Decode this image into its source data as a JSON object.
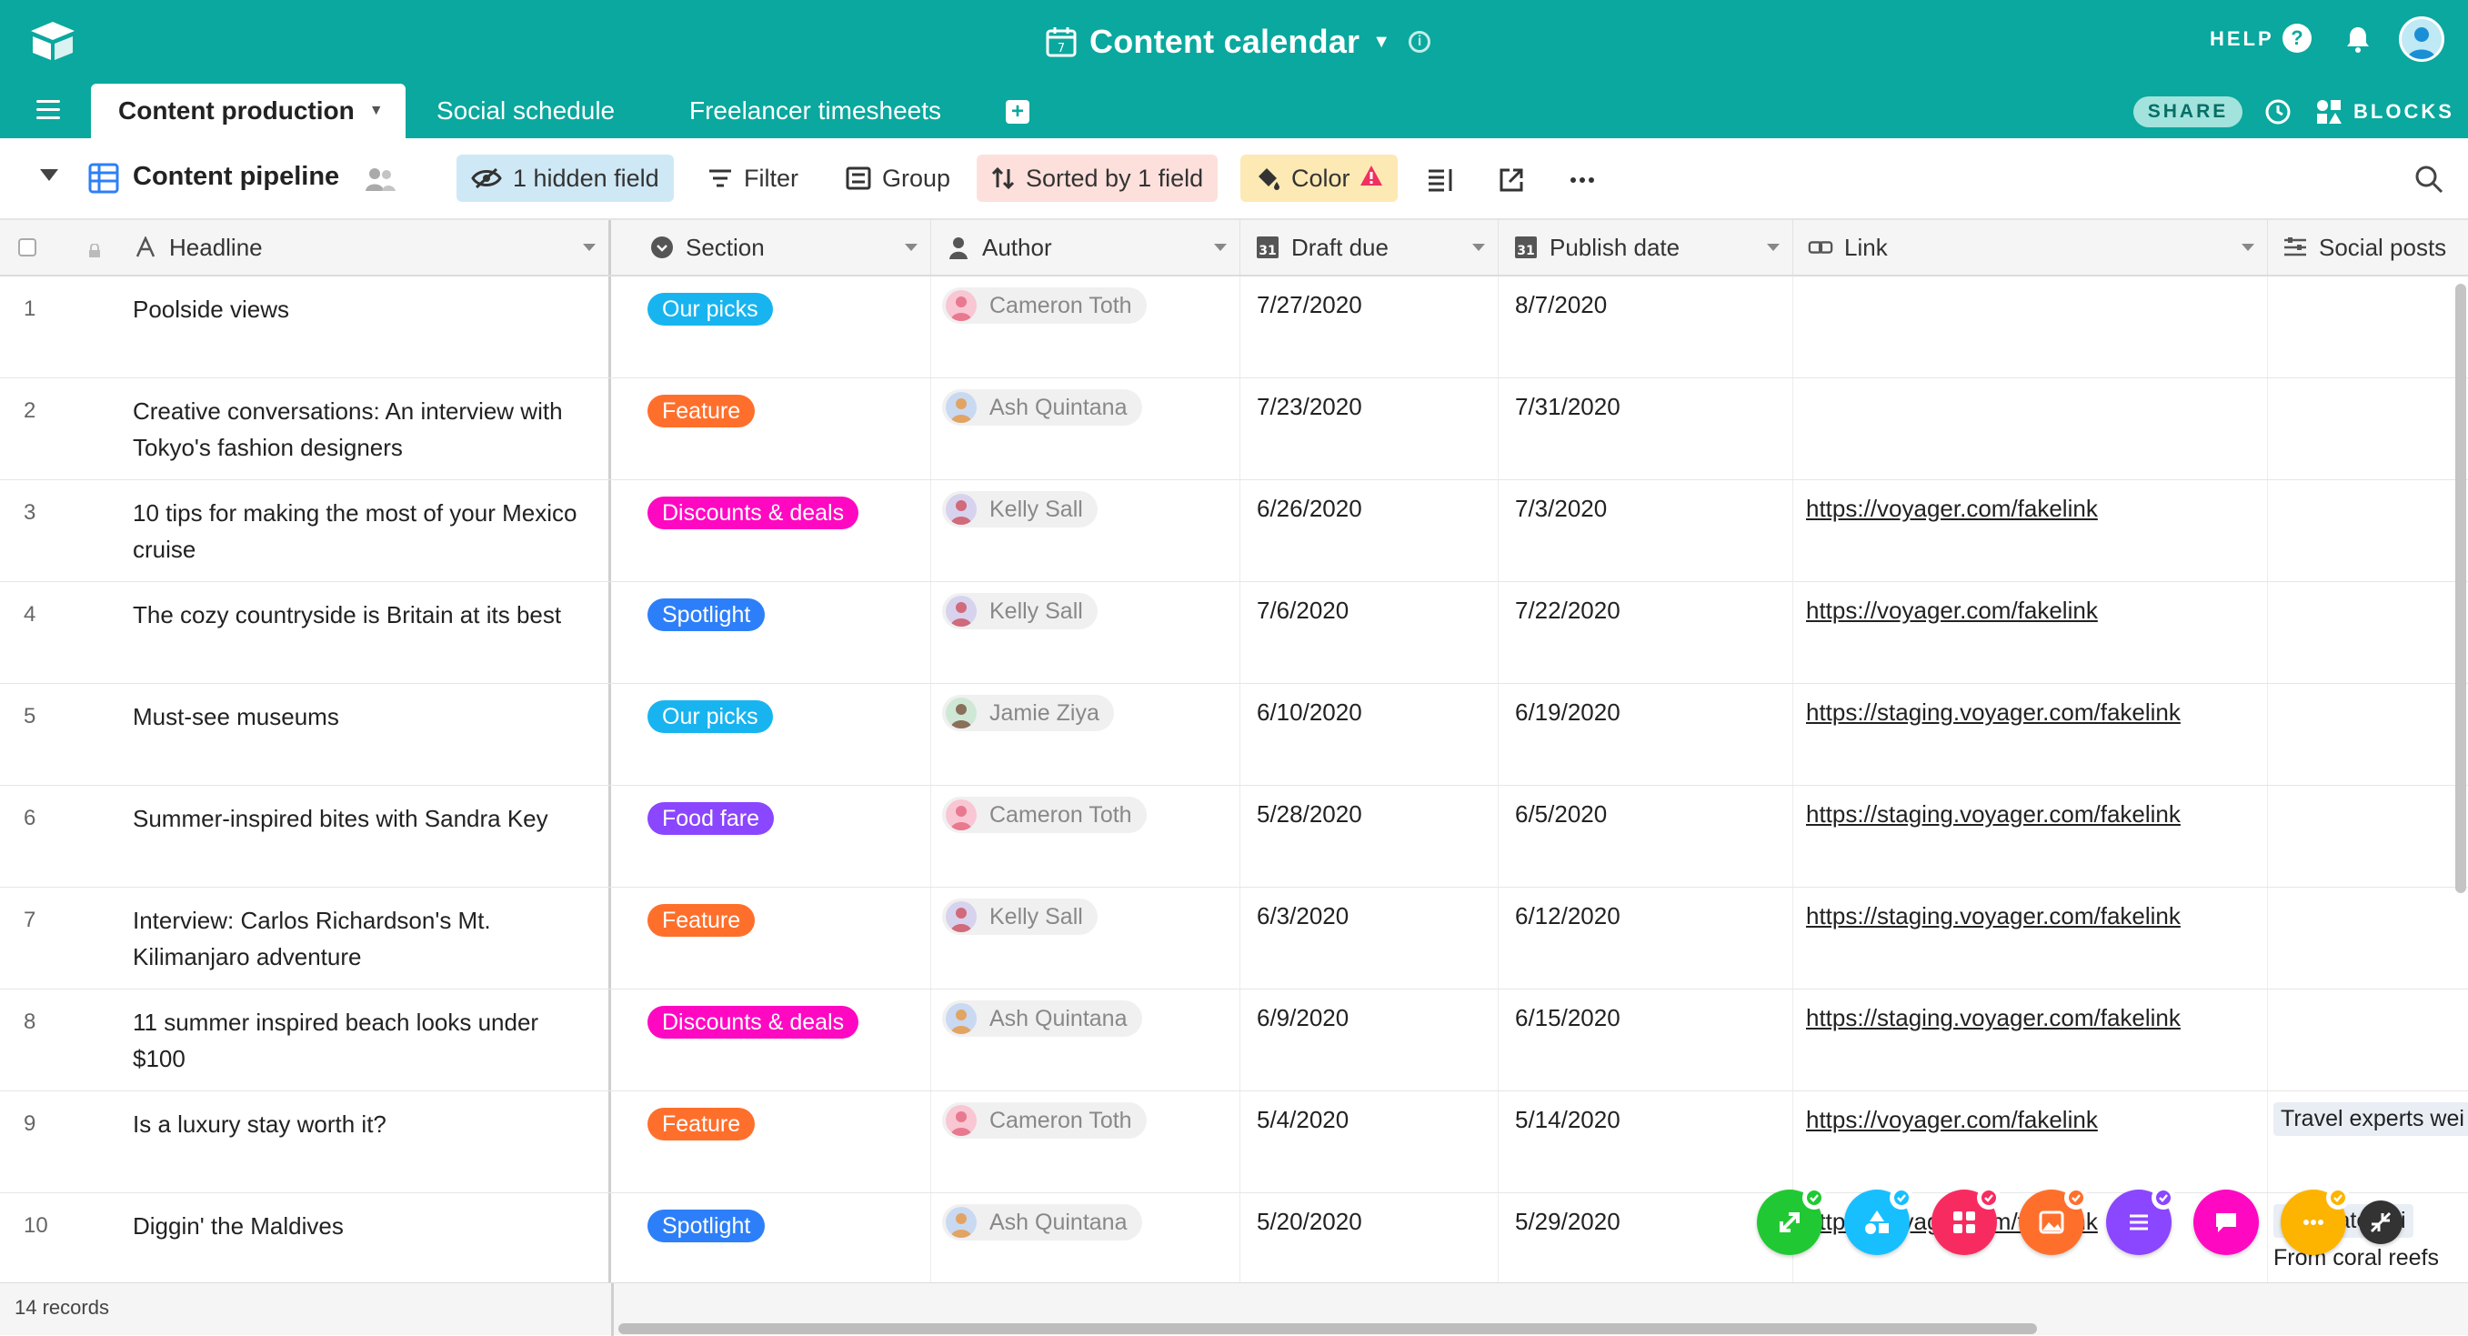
{
  "header": {
    "title": "Content calendar",
    "help": "HELP",
    "share": "SHARE",
    "blocks": "BLOCKS",
    "tabs": [
      {
        "label": "Content production"
      },
      {
        "label": "Social schedule"
      },
      {
        "label": "Freelancer timesheets"
      }
    ]
  },
  "toolbar": {
    "view_name": "Content pipeline",
    "hidden_fields": "1 hidden field",
    "filter": "Filter",
    "group": "Group",
    "sorted": "Sorted by 1 field",
    "color": "Color"
  },
  "columns": {
    "headline": "Headline",
    "section": "Section",
    "author": "Author",
    "draft_due": "Draft due",
    "publish_date": "Publish date",
    "link": "Link",
    "social_posts": "Social posts"
  },
  "rows": [
    {
      "num": "1",
      "headline": "Poolside views",
      "section": "Our picks",
      "author": "Cameron Toth",
      "draft": "7/27/2020",
      "publish": "8/7/2020",
      "link": "",
      "social": ""
    },
    {
      "num": "2",
      "headline": "Creative conversations: An interview with Tokyo's fashion designers",
      "section": "Feature",
      "author": "Ash Quintana",
      "draft": "7/23/2020",
      "publish": "7/31/2020",
      "link": "",
      "social": ""
    },
    {
      "num": "3",
      "headline": "10 tips for making the most of your Mexico cruise",
      "section": "Discounts & deals",
      "author": "Kelly Sall",
      "draft": "6/26/2020",
      "publish": "7/3/2020",
      "link": "https://voyager.com/fakelink",
      "social": ""
    },
    {
      "num": "4",
      "headline": "The cozy countryside is Britain at its best",
      "section": "Spotlight",
      "author": "Kelly Sall",
      "draft": "7/6/2020",
      "publish": "7/22/2020",
      "link": "https://voyager.com/fakelink",
      "social": ""
    },
    {
      "num": "5",
      "headline": "Must-see museums",
      "section": "Our picks",
      "author": "Jamie Ziya",
      "draft": "6/10/2020",
      "publish": "6/19/2020",
      "link": "https://staging.voyager.com/fakelink",
      "social": ""
    },
    {
      "num": "6",
      "headline": "Summer-inspired bites with Sandra Key",
      "section": "Food fare",
      "author": "Cameron Toth",
      "draft": "5/28/2020",
      "publish": "6/5/2020",
      "link": "https://staging.voyager.com/fakelink",
      "social": ""
    },
    {
      "num": "7",
      "headline": "Interview: Carlos Richardson's Mt. Kilimanjaro adventure",
      "section": "Feature",
      "author": "Kelly Sall",
      "draft": "6/3/2020",
      "publish": "6/12/2020",
      "link": "https://staging.voyager.com/fakelink",
      "social": ""
    },
    {
      "num": "8",
      "headline": "11 summer inspired beach looks under $100",
      "section": "Discounts & deals",
      "author": "Ash Quintana",
      "draft": "6/9/2020",
      "publish": "6/15/2020",
      "link": "https://staging.voyager.com/fakelink",
      "social": ""
    },
    {
      "num": "9",
      "headline": "Is a luxury stay worth it?",
      "section": "Feature",
      "author": "Cameron Toth",
      "draft": "5/4/2020",
      "publish": "5/14/2020",
      "link": "https://voyager.com/fakelink",
      "social": "Travel experts wei"
    },
    {
      "num": "10",
      "headline": "Diggin' the Maldives",
      "section": "Spotlight",
      "author": "Ash Quintana",
      "draft": "5/20/2020",
      "publish": "5/29/2020",
      "link": "https://voyager.com/fakelink",
      "social": "Cultivate gui",
      "social2": "From coral reefs"
    }
  ],
  "section_colors": {
    "Our picks": "#18b4f0",
    "Feature": "#ff6f2c",
    "Discounts & deals": "#ff08c2",
    "Spotlight": "#2d7ff9",
    "Food fare": "#8b46ff"
  },
  "footer": {
    "records": "14 records"
  },
  "floating_blocks": [
    {
      "icon": "expand-icon",
      "color": "#20c933"
    },
    {
      "icon": "shapes-icon",
      "color": "#18bfff"
    },
    {
      "icon": "apps-icon",
      "color": "#f82b60"
    },
    {
      "icon": "image-icon",
      "color": "#ff6f2c"
    },
    {
      "icon": "list-icon",
      "color": "#8b46ff"
    },
    {
      "icon": "chat-icon",
      "color": "#ff08c2"
    },
    {
      "icon": "more-icon",
      "color": "#fcb400"
    },
    {
      "icon": "collapse-icon",
      "color": "#333333"
    }
  ]
}
